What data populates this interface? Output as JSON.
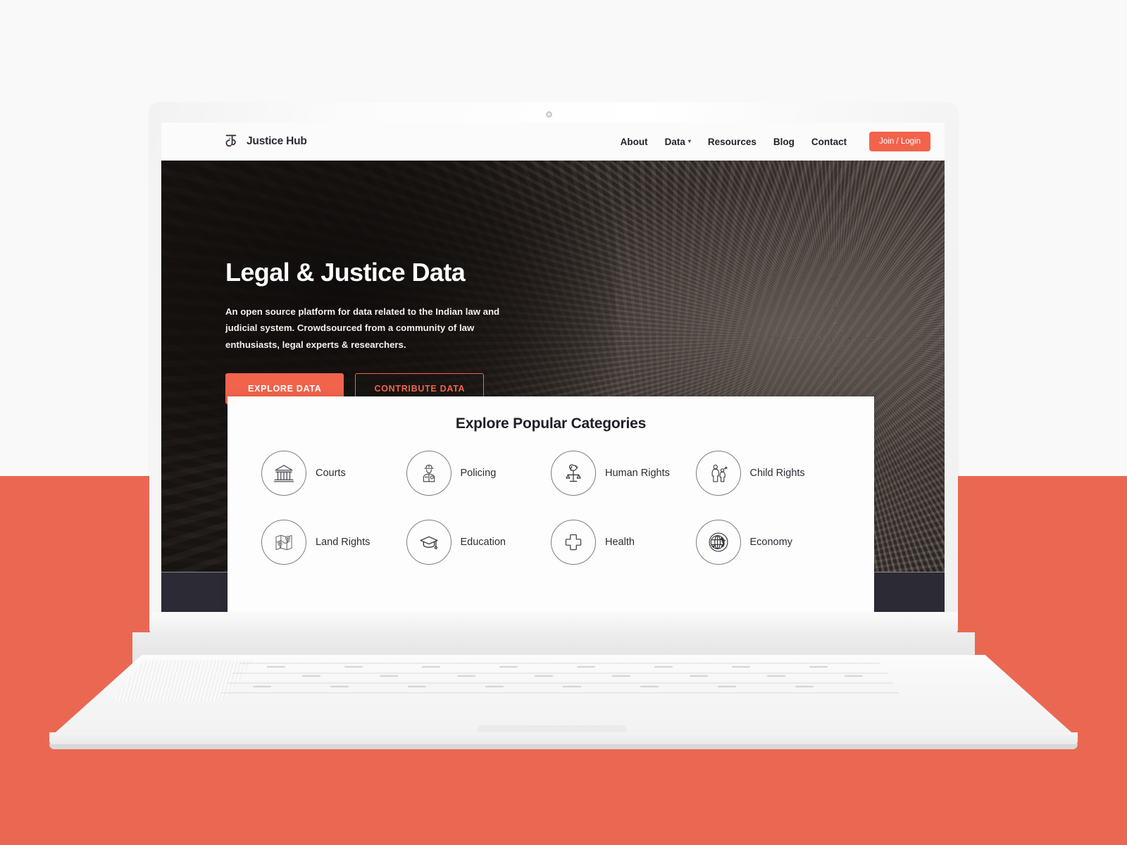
{
  "brand": {
    "name": "Justice Hub",
    "logo_icon": "justice-hub-monogram-icon",
    "accent_color": "#f2634c"
  },
  "nav": {
    "links": [
      {
        "label": "About",
        "has_dropdown": false
      },
      {
        "label": "Data",
        "has_dropdown": true,
        "caret": "▾"
      },
      {
        "label": "Resources",
        "has_dropdown": false
      },
      {
        "label": "Blog",
        "has_dropdown": false
      },
      {
        "label": "Contact",
        "has_dropdown": false
      }
    ],
    "cta": {
      "label": "Join / Login"
    }
  },
  "hero": {
    "title": "Legal & Justice Data",
    "subtitle": "An open source platform for data related to the Indian law and judicial system. Crowdsourced from a community of law enthusiasts, legal experts & researchers.",
    "primary_cta": "EXPLORE DATA",
    "secondary_cta": "CONTRIBUTE DATA",
    "background": "open-book-pages-photo"
  },
  "categories": {
    "title": "Explore Popular Categories",
    "items": [
      {
        "label": "Courts",
        "icon": "courthouse-icon"
      },
      {
        "label": "Policing",
        "icon": "police-officer-icon"
      },
      {
        "label": "Human Rights",
        "icon": "dove-on-scales-icon"
      },
      {
        "label": "Child Rights",
        "icon": "adult-and-child-icon"
      },
      {
        "label": "Land Rights",
        "icon": "map-with-pins-icon"
      },
      {
        "label": "Education",
        "icon": "graduation-cap-icon"
      },
      {
        "label": "Health",
        "icon": "medical-cross-icon"
      },
      {
        "label": "Economy",
        "icon": "globe-dollar-icon"
      }
    ]
  },
  "scene": {
    "device": "white-laptop-mockup",
    "backdrop_top_color": "#f9f9f9",
    "backdrop_bottom_color": "#ea6852",
    "footer_band_color": "#2b2a35"
  }
}
